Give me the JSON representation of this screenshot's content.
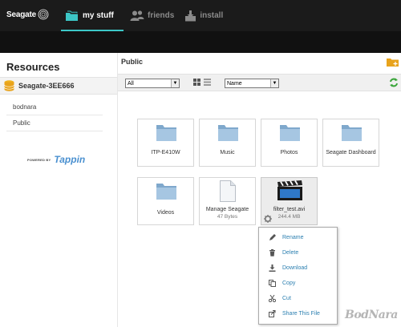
{
  "brand": {
    "name": "Seagate"
  },
  "nav": {
    "items": [
      {
        "label": "my stuff",
        "icon": "folders-icon",
        "active": true
      },
      {
        "label": "friends",
        "icon": "friends-icon",
        "active": false
      },
      {
        "label": "install",
        "icon": "install-icon",
        "active": false
      }
    ]
  },
  "sidebar": {
    "title": "Resources",
    "device": "Seagate-3EE666",
    "items": [
      {
        "label": "bodnara"
      },
      {
        "label": "Public"
      }
    ],
    "powered_by": "POWERED BY",
    "tappin": "Tappin"
  },
  "main": {
    "title": "Public",
    "filter": {
      "selected": "All"
    },
    "sort": {
      "selected": "Name"
    },
    "tiles": [
      {
        "type": "folder",
        "label": "ITP-E410W"
      },
      {
        "type": "folder",
        "label": "Music"
      },
      {
        "type": "folder",
        "label": "Photos"
      },
      {
        "type": "folder",
        "label": "Seagate Dashboard"
      },
      {
        "type": "folder",
        "label": "Videos"
      },
      {
        "type": "document",
        "label": "Manage Seagate",
        "sub": "47 Bytes"
      },
      {
        "type": "video",
        "label": "filter_test.avi",
        "sub": "244.4 MB"
      }
    ]
  },
  "context_menu": {
    "items": [
      {
        "label": "Rename",
        "icon": "pencil-icon"
      },
      {
        "label": "Delete",
        "icon": "trash-icon"
      },
      {
        "label": "Download",
        "icon": "download-icon"
      },
      {
        "label": "Copy",
        "icon": "copy-icon"
      },
      {
        "label": "Cut",
        "icon": "scissors-icon"
      },
      {
        "label": "Share This File",
        "icon": "share-icon"
      }
    ]
  },
  "watermark": "BodNara",
  "colors": {
    "accent": "#3cc7c7",
    "topbar": "#1b1b1b",
    "link": "#2b7fb0",
    "folder": "#8fb6d6",
    "device_icon": "#e8a31c"
  }
}
